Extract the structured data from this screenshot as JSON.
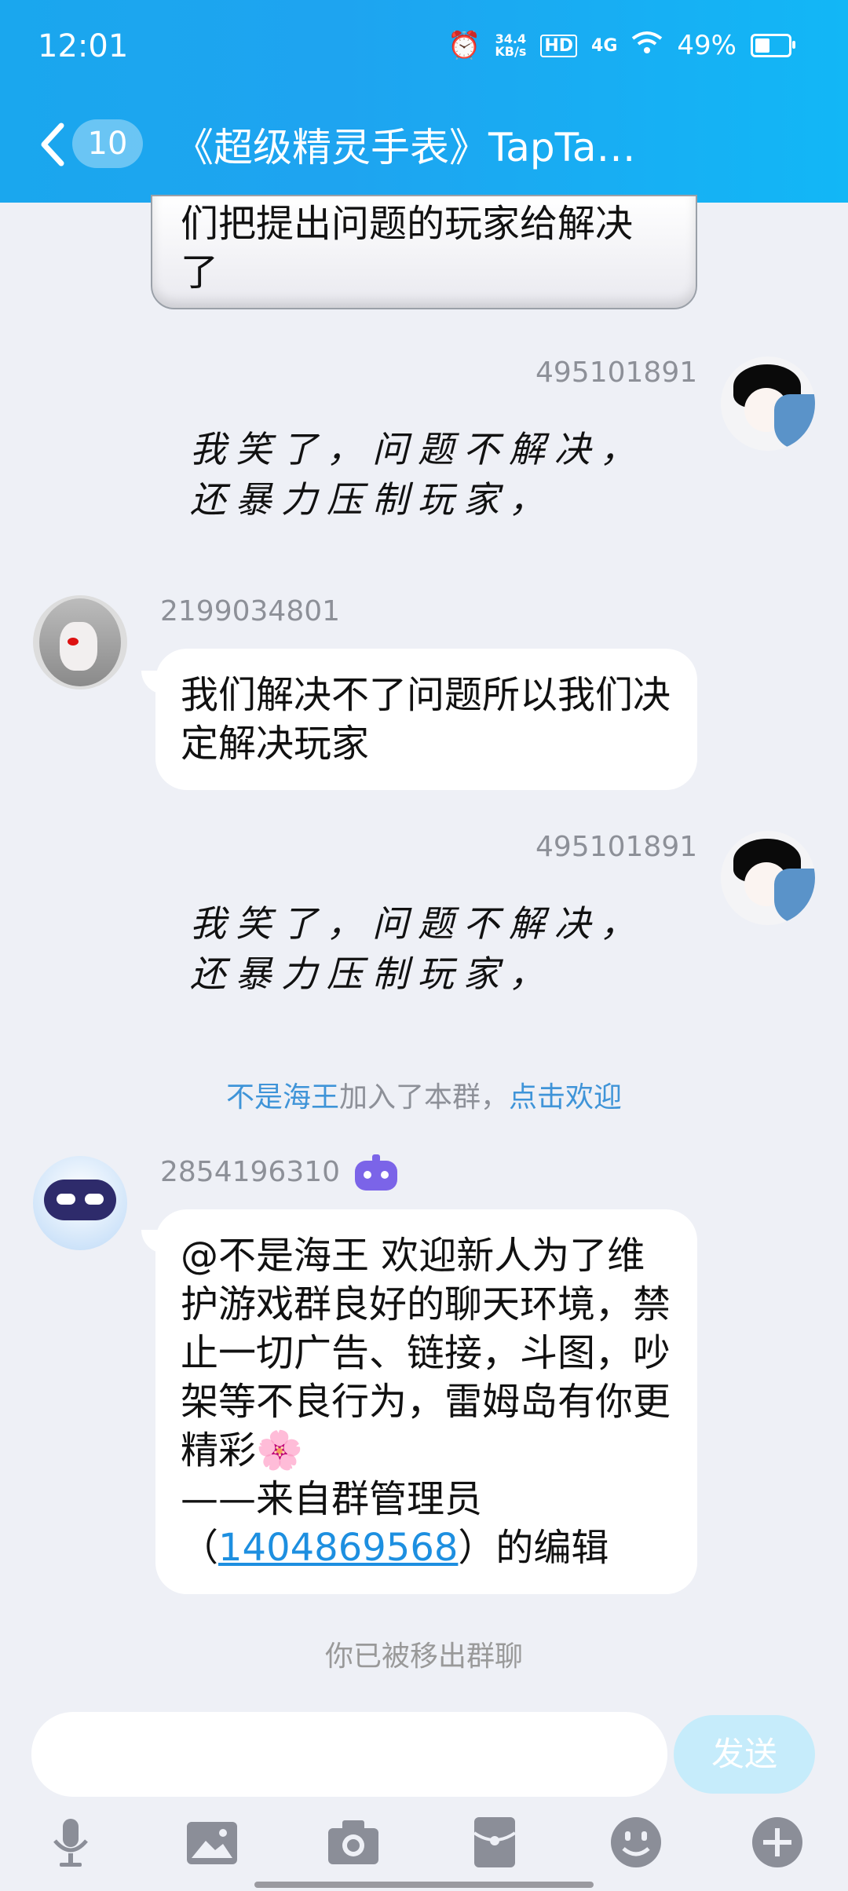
{
  "status": {
    "time": "12:01",
    "net_speed": "34.4",
    "net_unit": "KB/s",
    "hd": "HD",
    "network": "4G",
    "battery": "49%"
  },
  "nav": {
    "unread_count": "10",
    "title": "《超级精灵手表》TapTa…"
  },
  "messages": {
    "prev_tail": "们把提出问题的玩家给解决了",
    "m1": {
      "sender": "495101891",
      "text": "我笑了，问题不解决，还暴力压制玩家，"
    },
    "m2": {
      "sender": "2199034801",
      "text": "我们解决不了问题所以我们决定解决玩家"
    },
    "m3": {
      "sender": "495101891",
      "text": "我笑了，问题不解决，还暴力压制玩家，"
    },
    "join_name": "不是海王",
    "join_text": "加入了本群，",
    "join_welcome": "点击欢迎",
    "m4": {
      "sender": "2854196310",
      "line1": "@不是海王 欢迎新人为了维护游戏群良好的聊天环境，禁止一切广告、链接，斗图，吵架等不良行为，雷姆岛有你更精彩🌸",
      "line2": "——来自群管理员",
      "paren_open": "（",
      "qq": "1404869568",
      "paren_close": "）的编辑"
    },
    "removed_note": "你已被移出群聊"
  },
  "input": {
    "placeholder": "",
    "send_label": "发送"
  },
  "colors": {
    "header": "#1aa7ee",
    "link": "#3f94d8",
    "send_bg": "#c6ecfb"
  }
}
